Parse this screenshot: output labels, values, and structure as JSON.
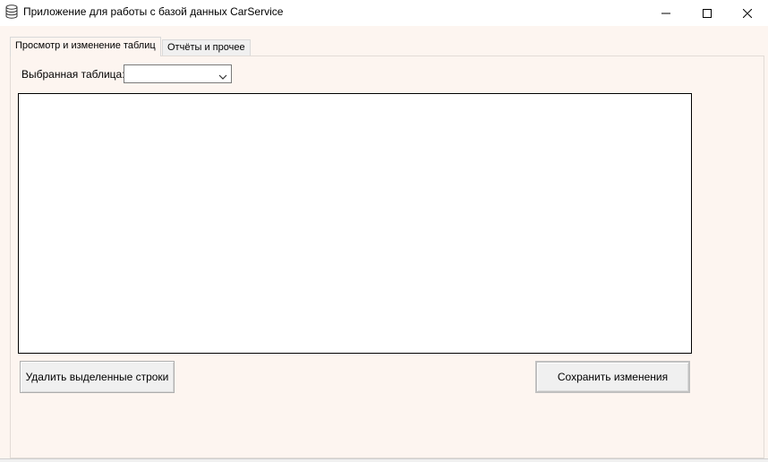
{
  "window": {
    "title": "Приложение для работы с базой данных CarService",
    "icon": "database-icon",
    "controls": {
      "minimize": "minimize-icon",
      "maximize": "maximize-icon",
      "close": "close-icon"
    }
  },
  "tabs": [
    {
      "label": "Просмотр и изменение таблиц",
      "active": true
    },
    {
      "label": "Отчёты и прочее",
      "active": false
    }
  ],
  "table_selector": {
    "label": "Выбранная таблица:",
    "value": ""
  },
  "buttons": {
    "delete_rows": "Удалить выделенные строки",
    "save_changes": "Сохранить изменения"
  },
  "colors": {
    "form_background": "#fdf5f0",
    "grid_background": "#ffffff",
    "titlebar": "#ffffff"
  }
}
